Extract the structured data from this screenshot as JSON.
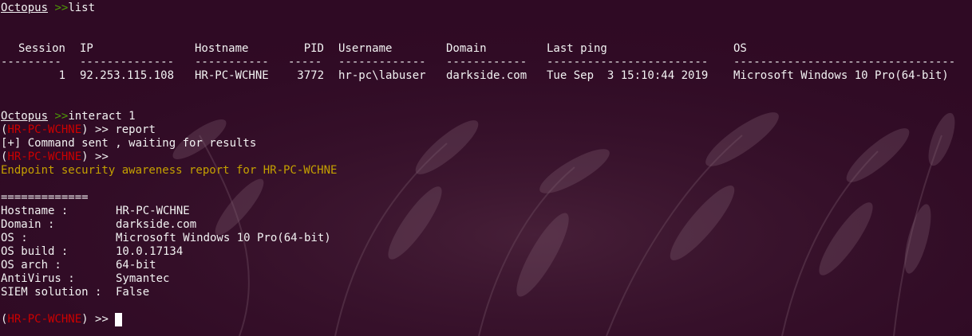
{
  "prompt": {
    "name": "Octopus",
    "symbol": ">>",
    "list_cmd": "list",
    "interact_cmd": "interact 1"
  },
  "table": {
    "headers": [
      "Session",
      "IP",
      "Hostname",
      "PID",
      "Username",
      "Domain",
      "Last ping",
      "OS"
    ],
    "separators": [
      "---------",
      "--------------",
      "-----------",
      "-----",
      "-------------",
      "------------",
      "------------------------",
      "---------------------------------"
    ],
    "rows": [
      [
        "1",
        "92.253.115.108",
        "HR-PC-WCHNE",
        "3772",
        "hr-pc\\labuser",
        "darkside.com",
        "Tue Sep  3 15:10:44 2019",
        "Microsoft Windows 10 Pro(64-bit)"
      ]
    ]
  },
  "session": {
    "host": "HR-PC-WCHNE",
    "open": "(",
    "close": ")",
    "symbol": ">>",
    "report_cmd": "report",
    "status": "[+] Command sent , waiting for results",
    "report_title": "Endpoint security awareness report for HR-PC-WCHNE"
  },
  "report": {
    "divider": "=============",
    "fields": [
      {
        "label": "Hostname :",
        "value": "HR-PC-WCHNE"
      },
      {
        "label": "Domain :",
        "value": "darkside.com"
      },
      {
        "label": "OS :",
        "value": "Microsoft Windows 10 Pro(64-bit)"
      },
      {
        "label": "OS build :",
        "value": "10.0.17134"
      },
      {
        "label": "OS arch :",
        "value": "64-bit"
      },
      {
        "label": "AntiVirus :",
        "value": "Symantec"
      },
      {
        "label": "SIEM solution :",
        "value": "False"
      }
    ]
  },
  "colors": {
    "background": "#2f0a24",
    "prompt_green": "#4e9a06",
    "host_red": "#cc0000",
    "report_yellow": "#c4a000",
    "text": "#f2f2f2"
  }
}
